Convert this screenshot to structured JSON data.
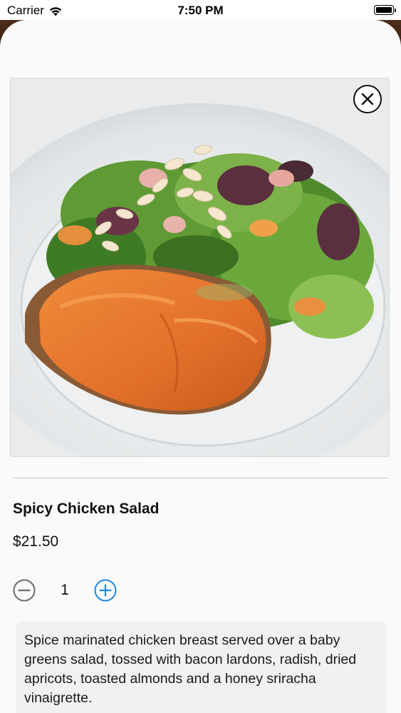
{
  "status_bar": {
    "carrier": "Carrier",
    "time": "7:50 PM"
  },
  "item": {
    "name": "Spicy Chicken Salad",
    "price": "$21.50",
    "quantity": "1",
    "description": "Spice marinated chicken breast served over a baby greens salad, tossed with bacon lardons, radish, dried apricots, toasted almonds and a honey sriracha vinaigrette."
  },
  "icons": {
    "close": "close-circle-icon",
    "decrease": "minus-circle-icon",
    "increase": "plus-circle-icon",
    "wifi": "wifi-icon",
    "battery": "battery-icon"
  },
  "colors": {
    "accent": "#1e88e5",
    "stepper_disabled": "#6b6b6b",
    "backdrop": "#4a2a1a"
  }
}
